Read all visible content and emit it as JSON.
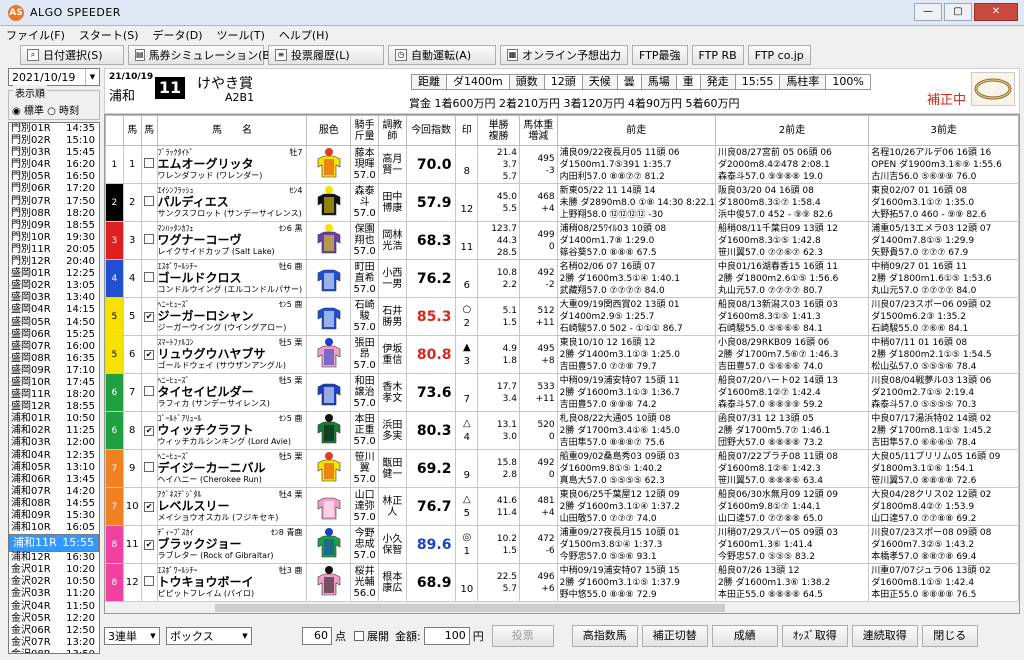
{
  "window": {
    "title": "ALGO SPEEDER",
    "app_icon": "AS",
    "controls": [
      "—",
      "▢",
      "✕"
    ]
  },
  "menu": [
    "ファイル(F)",
    "スタート(S)",
    "データ(D)",
    "ツール(T)",
    "ヘルプ(H)"
  ],
  "toolbar": [
    {
      "label": "日付選択(S)",
      "icon": "search-icon"
    },
    {
      "label": "馬券シミュレーション(B)",
      "icon": "ticket-icon"
    },
    {
      "label": "投票履歴(L)",
      "icon": "history-icon"
    },
    {
      "label": "自動運転(A)",
      "icon": "auto-icon"
    },
    {
      "label": "オンライン予想出力",
      "icon": "online-icon"
    },
    {
      "label": "FTP最強",
      "icon": ""
    },
    {
      "label": "FTP RB",
      "icon": ""
    },
    {
      "label": "FTP co.jp",
      "icon": ""
    }
  ],
  "left": {
    "date": "2021/10/19",
    "order_label": "表示順",
    "order_options": [
      "◉ 標準",
      "○ 時刻"
    ],
    "races": [
      [
        "門別01R",
        "14:35"
      ],
      [
        "門別02R",
        "15:10"
      ],
      [
        "門別03R",
        "15:45"
      ],
      [
        "門別04R",
        "16:20"
      ],
      [
        "門別05R",
        "16:50"
      ],
      [
        "門別06R",
        "17:20"
      ],
      [
        "門別07R",
        "17:50"
      ],
      [
        "門別08R",
        "18:20"
      ],
      [
        "門別09R",
        "18:55"
      ],
      [
        "門別10R",
        "19:30"
      ],
      [
        "門別11R",
        "20:05"
      ],
      [
        "門別12R",
        "20:40"
      ],
      [
        "盛岡01R",
        "12:25"
      ],
      [
        "盛岡02R",
        "13:05"
      ],
      [
        "盛岡03R",
        "13:40"
      ],
      [
        "盛岡04R",
        "14:15"
      ],
      [
        "盛岡05R",
        "14:50"
      ],
      [
        "盛岡06R",
        "15:25"
      ],
      [
        "盛岡07R",
        "16:00"
      ],
      [
        "盛岡08R",
        "16:35"
      ],
      [
        "盛岡09R",
        "17:10"
      ],
      [
        "盛岡10R",
        "17:45"
      ],
      [
        "盛岡11R",
        "18:20"
      ],
      [
        "盛岡12R",
        "18:55"
      ],
      [
        "浦和01R",
        "10:50"
      ],
      [
        "浦和02R",
        "11:25"
      ],
      [
        "浦和03R",
        "12:00"
      ],
      [
        "浦和04R",
        "12:35"
      ],
      [
        "浦和05R",
        "13:10"
      ],
      [
        "浦和06R",
        "13:45"
      ],
      [
        "浦和07R",
        "14:20"
      ],
      [
        "浦和08R",
        "14:55"
      ],
      [
        "浦和09R",
        "15:30"
      ],
      [
        "浦和10R",
        "16:05"
      ],
      [
        "浦和11R",
        "15:55"
      ],
      [
        "浦和12R",
        "16:30"
      ],
      [
        "金沢01R",
        "10:20"
      ],
      [
        "金沢02R",
        "10:50"
      ],
      [
        "金沢03R",
        "11:20"
      ],
      [
        "金沢04R",
        "11:50"
      ],
      [
        "金沢05R",
        "12:20"
      ],
      [
        "金沢06R",
        "12:50"
      ],
      [
        "金沢07R",
        "13:20"
      ],
      [
        "金沢08R",
        "13:50"
      ],
      [
        "金沢09R",
        "14:20"
      ]
    ],
    "selected_index": 34
  },
  "header": {
    "date": "21/10/19",
    "track": "浦和",
    "race_no": "11",
    "race_name": "けやき賞",
    "class": "A2B1",
    "cond": [
      [
        "距離",
        false
      ],
      [
        "ダ1400m",
        true
      ],
      [
        "頭数",
        false
      ],
      [
        "12頭",
        true
      ],
      [
        "天候",
        false
      ],
      [
        "曇",
        true
      ],
      [
        "馬場",
        false
      ],
      [
        "重",
        true
      ],
      [
        "発走",
        false
      ],
      [
        "15:55",
        true
      ],
      [
        "馬柱率",
        false
      ],
      [
        "100%",
        true
      ]
    ],
    "prize": "賞金 1着600万円  2着210万円  3着120万円  4着90万円  5着60万円",
    "hosei": "補正中"
  },
  "columns": [
    "",
    "馬",
    "馬",
    "馬　　名",
    "服色",
    "騎手\n斤量",
    "調教\n師",
    "今回指数",
    "印",
    "単勝\n複勝",
    "馬体重\n増減",
    "前走",
    "2前走",
    "3前走"
  ],
  "horses": [
    {
      "waku": "1",
      "waku_color": "#ffffff",
      "uma": "1",
      "check": false,
      "sire": "ﾌﾞﾗｯｸﾀｲﾄﾞ",
      "age": "牡7",
      "name": "エムオーグリッタ",
      "dam": "ワレンダフッド (ワレンダー)",
      "silk": [
        "#f5e200",
        "#e03b2c"
      ],
      "jockey": "藤本\n現暉\n57.0",
      "trainer": "高月\n賢一",
      "score": "70.0",
      "score_color": "#000000",
      "mark": "\n8",
      "odds": "21.4\n3.7\n5.7",
      "wt": "495\n-3\n",
      "r1": [
        "浦良09/22夜長月05 11頭 06",
        "ダ1500m1.7⑤391 1:35.7",
        "内田利57.0 ⑧⑧⑦⑦ 81.2"
      ],
      "r2": [
        "川良08/27宮前 05 06頭 06",
        "ダ2000m8.4②478 2:08.1",
        "森泰斗57.0 ⑨⑨⑧⑧ 19.0"
      ],
      "r3": [
        "名程10/26アルデ06 16頭 16",
        "OPEN ダ1900m3.1⑥⑨ 1:55.6",
        "古川吉56.0 ⑤⑥⑨⑨ 76.0"
      ]
    },
    {
      "waku": "2",
      "waku_color": "#000000",
      "uma": "2",
      "check": false,
      "sire": "ｴｲｼﾝﾌﾗｯｼｭ",
      "age": "ｾﾝ4",
      "name": "パルディエス",
      "dam": "サンクスフロット (サンデーサイレンス)",
      "silk": [
        "#111111",
        "#f5e200"
      ],
      "jockey": "森泰\n斗\n57.0",
      "trainer": "田中\n博康",
      "score": "57.9",
      "score_color": "#000000",
      "mark": "\n12",
      "odds": "45.0\n5.5\n",
      "wt": "468\n+4\n",
      "r1": [
        "新東05/22 11 14頭 14",
        "未勝 ダ2890m8.0 ①⑧ 14:30 8:22.1",
        "上野翔58.0 ⑫⑫⑫⑫ -30"
      ],
      "r2": [
        "阪良03/20 04 16頭 08",
        "ダ1800m8.3①⑦ 1:58.4",
        "浜中俊57.0 452 - ⑨⑨ 82.6"
      ],
      "r3": [
        "東良02/07 01 16頭 08",
        "ダ1600m3.1①⑦ 1:35.0",
        "大野拓57.0 460 - ⑨⑨ 82.6"
      ]
    },
    {
      "waku": "3",
      "waku_color": "#e02020",
      "uma": "3",
      "check": false,
      "sire": "ﾏﾝﾊｯﾀﾝｶﾌｪ",
      "age": "ｾﾝ6 黒",
      "name": "ワグナーコーヴ",
      "dam": "レイクサイドカップ (Salt Lake)",
      "silk": [
        "#6a3fb0",
        "#f5e200"
      ],
      "jockey": "保園\n翔也\n57.0",
      "trainer": "岡林\n光浩",
      "score": "68.3",
      "score_color": "#000000",
      "mark": "\n11",
      "odds": "123.7\n44.3\n28.5",
      "wt": "499\n0\n",
      "r1": [
        "浦稍08/25ﾜｲﾙ03 10頭 08",
        "ダ1400m1.7⑧ 1:29.0",
        "篠谷葵57.0 ⑧⑧⑧ 67.5"
      ],
      "r2": [
        "船稍08/11千葉日09 13頭 12",
        "ダ1600m8.3①⑤ 1:42.8",
        "笹川翼57.0 ⑦⑦⑥⑦ 62.3"
      ],
      "r3": [
        "浦重05/13エメラ03 12頭 07",
        "ダ1400m7.8①⑤ 1:29.9",
        "矢野貴57.0 ⑦⑦⑦ 67.9"
      ]
    },
    {
      "waku": "4",
      "waku_color": "#2050d0",
      "uma": "4",
      "check": false,
      "sire": "ｴｽﾎﾟﾜｰﾙｼﾁｰ",
      "age": "牡6 鹿",
      "name": "ゴールドクロス",
      "dam": "コンドルウイング (エルコンドルパサー)",
      "silk": [
        "#2050d0",
        "#ffffff"
      ],
      "jockey": "町田\n直希\n57.0",
      "trainer": "小西\n一男",
      "score": "76.2",
      "score_color": "#000000",
      "mark": "\n6",
      "odds": "10.8\n2.2\n",
      "wt": "492\n-2\n",
      "r1": [
        "名稍02/06 07 16頭 07",
        "2勝 ダ1600m3.5①④ 1:40.1",
        "武藏翔57.0 ⑦⑦⑦⑦ 84.0"
      ],
      "r2": [
        "中良01/16湖春香15 16頭 11",
        "2勝 ダ1800m2.6①⑤ 1:56.6",
        "丸山元57.0 ⑦⑦⑦⑦ 80.7"
      ],
      "r3": [
        "中稍09/27 01 16頭 11",
        "2勝 ダ1800m1.6①⑤ 1:53.6",
        "丸山元57.0 ⑦⑦⑦⑦ 84.0"
      ]
    },
    {
      "waku": "5",
      "waku_color": "#f5e200",
      "uma": "5",
      "check": true,
      "sire": "ﾍﾆｰﾋｭｰｽﾞ",
      "age": "ｾﾝ5 鹿",
      "name": "ジーガーロシャン",
      "dam": "ジーガーウイング (ウイングアロー)",
      "silk": [
        "#2050d0",
        "#ffffff"
      ],
      "jockey": "石崎\n駿\n57.0",
      "trainer": "石井\n勝男",
      "score": "85.3",
      "score_color": "#d8281e",
      "mark": "○\n2",
      "odds": "5.1\n1.5\n",
      "wt": "512\n+11\n",
      "r1": [
        "大重09/19関西賞02 13頭 01",
        "ダ1400m2.9⑤ 1:25.7",
        "石崎駿57.0 502 - ①①① 86.7"
      ],
      "r2": [
        "船良08/13新潟ス03 16頭 03",
        "ダ1600m8.3①⑤ 1:41.3",
        "石崎駿55.0 ⑤⑥⑥⑥ 84.1"
      ],
      "r3": [
        "川良07/23スポー06 09頭 02",
        "ダ1500m6.2③ 1:35.2",
        "石崎駿55.0 ⑦⑥⑥ 84.1"
      ]
    },
    {
      "waku": "5",
      "waku_color": "#f5e200",
      "uma": "6",
      "check": true,
      "sire": "ｽﾏｰﾄﾌｧﾙｺﾝ",
      "age": "牡5 栗",
      "name": "リュウグウハヤブサ",
      "dam": "ゴールドウェイ (サウザンアングル)",
      "silk": [
        "#f0a0c8",
        "#1b3fc6"
      ],
      "jockey": "張田\n昂\n57.0",
      "trainer": "伊坂\n重信",
      "score": "80.8",
      "score_color": "#d8281e",
      "mark": "▲\n3",
      "odds": "4.9\n1.8\n",
      "wt": "495\n+8\n",
      "r1": [
        "東良10/10 12 16頭 12",
        "2勝 ダ1400m3.1①③ 1:25.0",
        "吉田豊57.0 ⑦⑦⑧ 79.7"
      ],
      "r2": [
        "小良08/29RKB09 16頭 06",
        "2勝 ダ1700m7.5⑥⑦ 1:46.3",
        "吉田豊57.0 ⑤⑥⑥⑥ 74.0"
      ],
      "r3": [
        "中稍07/11 01 16頭 08",
        "2勝 ダ1800m2.1①⑤ 1:54.5",
        "松山弘57.0 ⑤⑤⑤⑥ 78.4"
      ]
    },
    {
      "waku": "6",
      "waku_color": "#20a040",
      "uma": "7",
      "check": false,
      "sire": "ﾍﾆｰﾋｭｰｽﾞ",
      "age": "牡5 栗",
      "name": "タイセイビルダー",
      "dam": "ラフィカ (サンデーサイレンス)",
      "silk": [
        "#1b3fc6",
        "#ffffff"
      ],
      "jockey": "和田\n譲治\n57.0",
      "trainer": "香木\n孝文",
      "score": "73.6",
      "score_color": "#000000",
      "mark": "\n7",
      "odds": "17.7\n3.4\n",
      "wt": "533\n+11\n",
      "r1": [
        "中稍09/19浦安特07 15頭 11",
        "2勝 ダ1600m3.1①③ 1:36.7",
        "吉田豊57.0 ⑨⑨⑧ 74.2"
      ],
      "r2": [
        "船良07/20ハート02 14頭 13",
        "ダ1600m8.1②⑦ 1:42.4",
        "森泰斗57.0 ⑧⑧⑨⑨ 59.2"
      ],
      "r3": [
        "川良08/04戦夢ル03 13頭 06",
        "ダ2100m2.7①⑤ 2:19.4",
        "森泰斗57.0 ⑤⑤⑤⑤ 70.3"
      ]
    },
    {
      "waku": "6",
      "waku_color": "#20a040",
      "uma": "8",
      "check": true,
      "sire": "ｺﾞｰﾙﾄﾞｱﾘｭｰﾙ",
      "age": "ｾﾝ5 鹿",
      "name": "ウィッチクラフト",
      "dam": "ウィッチカルシンキング (Lord Avie)",
      "silk": [
        "#1a7a38",
        "#111111"
      ],
      "jockey": "本田\n正重\n57.0",
      "trainer": "浜田\n多実",
      "score": "80.3",
      "score_color": "#000000",
      "mark": "△\n4",
      "odds": "13.1\n3.0\n",
      "wt": "520\n0\n",
      "r1": [
        "札良08/22大通05 10頭 08",
        "2勝 ダ1700m3.4①⑥ 1:45.0",
        "吉田隼57.0 ⑧⑧⑧⑦ 75.6"
      ],
      "r2": [
        "函良07/31 12 13頭 05",
        "2勝 ダ1700m5.7⑦ 1:46.1",
        "団野大57.0 ⑧⑧⑧⑧ 73.2"
      ],
      "r3": [
        "中良07/17湯浜特02 14頭 02",
        "2勝 ダ1700m8.1①⑤ 1:45.2",
        "吉田隼57.0 ⑥⑥⑥⑤ 78.4"
      ]
    },
    {
      "waku": "7",
      "waku_color": "#f08020",
      "uma": "9",
      "check": false,
      "sire": "ﾍﾆｰﾋｭｰｽﾞ",
      "age": "牡5 栗",
      "name": "デイジーカーニバル",
      "dam": "ヘイハニー (Cherokee Run)",
      "silk": [
        "#f5e200",
        "#e03b2c"
      ],
      "jockey": "笹川\n翼\n57.0",
      "trainer": "甑田\n健一",
      "score": "69.2",
      "score_color": "#000000",
      "mark": "\n9",
      "odds": "15.8\n2.8\n",
      "wt": "492\n0\n",
      "r1": [
        "船重09/02桑島秀03 09頭 03",
        "ダ1600m9.8①⑤ 1:40.2",
        "真島大57.0 ⑤⑤⑤⑤ 62.3"
      ],
      "r2": [
        "船良07/22プラチ08 11頭 08",
        "ダ1600m8.1②⑥ 1:42.3",
        "笹川翼57.0 ⑧⑧⑧⑥ 63.4"
      ],
      "r3": [
        "大良05/11ブリリム05 16頭 09",
        "ダ1800m3.1①⑥ 1:54.1",
        "笹川翼57.0 ⑧⑧⑧⑧ 72.6"
      ]
    },
    {
      "waku": "7",
      "waku_color": "#f08020",
      "uma": "10",
      "check": true,
      "sire": "ｱｸﾞﾈｽﾃﾞｼﾞﾀﾙ",
      "age": "牡4 栗",
      "name": "レベルスリー",
      "dam": "メイショウオスカル (フジキセキ)",
      "silk": [
        "#f0a0c8",
        "#ffffff"
      ],
      "jockey": "山口\n達弥\n57.0",
      "trainer": "林正\n人",
      "score": "76.7",
      "score_color": "#000000",
      "mark": "△\n5",
      "odds": "41.6\n11.4\n",
      "wt": "481\n+4\n",
      "r1": [
        "東良06/25千葉屋12 12頭 09",
        "2勝 ダ1600m3.1①④ 1:37.2",
        "山田敬57.0 ⑦⑦⑦ 74.0"
      ],
      "r2": [
        "船良06/30水無月09 12頭 09",
        "ダ1600m9.8①⑦ 1:44.1",
        "山口達57.0 ⑦⑦⑧⑧ 65.0"
      ],
      "r3": [
        "大良04/28クリス02 12頭 02",
        "ダ1800m8.4②⑦ 1:53.9",
        "山口達57.0 ⑦⑦⑧⑧ 69.2"
      ]
    },
    {
      "waku": "8",
      "waku_color": "#f040a0",
      "uma": "11",
      "check": true,
      "sire": "ﾃﾞｨｰﾌﾟｽｶｲ",
      "age": "ｾﾝ8 青鹿",
      "name": "ブラックジョー",
      "dam": "ラブレター (Rock of Gibraltar)",
      "silk": [
        "#20a040",
        "#1b3fc6"
      ],
      "jockey": "今野\n忠成\n57.0",
      "trainer": "小久\n保智",
      "score": "89.6",
      "score_color": "#1b3fc6",
      "mark": "◎\n1",
      "odds": "10.2\n1.5\n",
      "wt": "472\n-6\n",
      "r1": [
        "浦重09/27夜長月15 10頭 01",
        "ダ1500m3.8①④ 1:37.3",
        "今野忠57.0 ⑤⑤⑥ 93.1"
      ],
      "r2": [
        "川稍07/29スパー05 09頭 03",
        "ダ1600m1.3⑥ 1:41.4",
        "今野忠57.0 ⑤⑤⑤ 83.2"
      ],
      "r3": [
        "川良07/23スポー08 09頭 08",
        "ダ1600m7.3②⑤ 1:43.2",
        "本橋孝57.0 ⑧⑧⑦⑧ 69.4"
      ]
    },
    {
      "waku": "8",
      "waku_color": "#f040a0",
      "uma": "12",
      "check": false,
      "sire": "ｴｽﾎﾟﾜｰﾙｼﾁｰ",
      "age": "牡3 鹿",
      "name": "トウキョウボーイ",
      "dam": "ピピットフレイム (パイロ)",
      "silk": [
        "#f0a0c8",
        "#111111"
      ],
      "jockey": "桜井\n光輔\n56.0",
      "trainer": "根本\n康広",
      "score": "68.9",
      "score_color": "#000000",
      "mark": "\n10",
      "odds": "22.5\n5.7\n",
      "wt": "496\n+6\n",
      "r1": [
        "中稍09/19浦安特07 15頭 15",
        "2勝 ダ1600m3.1①⑤ 1:37.9",
        "野中悠55.0 ⑧⑧⑧ 72.9"
      ],
      "r2": [
        "船良07/26 13頭 12",
        "2勝 ダ1600m1.3⑥ 1:38.2",
        "本田正55.0 ⑧⑧⑧⑧ 64.5"
      ],
      "r3": [
        "川重07/07ジュラ06 13頭 02",
        "ダ1600m8.1①⑤ 1:42.4",
        "本田正55.0 ⑧⑧⑧⑧ 76.5"
      ]
    }
  ],
  "bottom": {
    "bet_type": "3連単",
    "bet_method": "ボックス",
    "points": "60",
    "points_unit": "点",
    "expand_label": "展開",
    "amount_label": "金額:",
    "amount": "100",
    "amount_unit": "円",
    "buttons": [
      "投票",
      "高指数馬",
      "補正切替",
      "成績",
      "ｵｯｽﾞ取得",
      "連続取得",
      "閉じる"
    ]
  }
}
